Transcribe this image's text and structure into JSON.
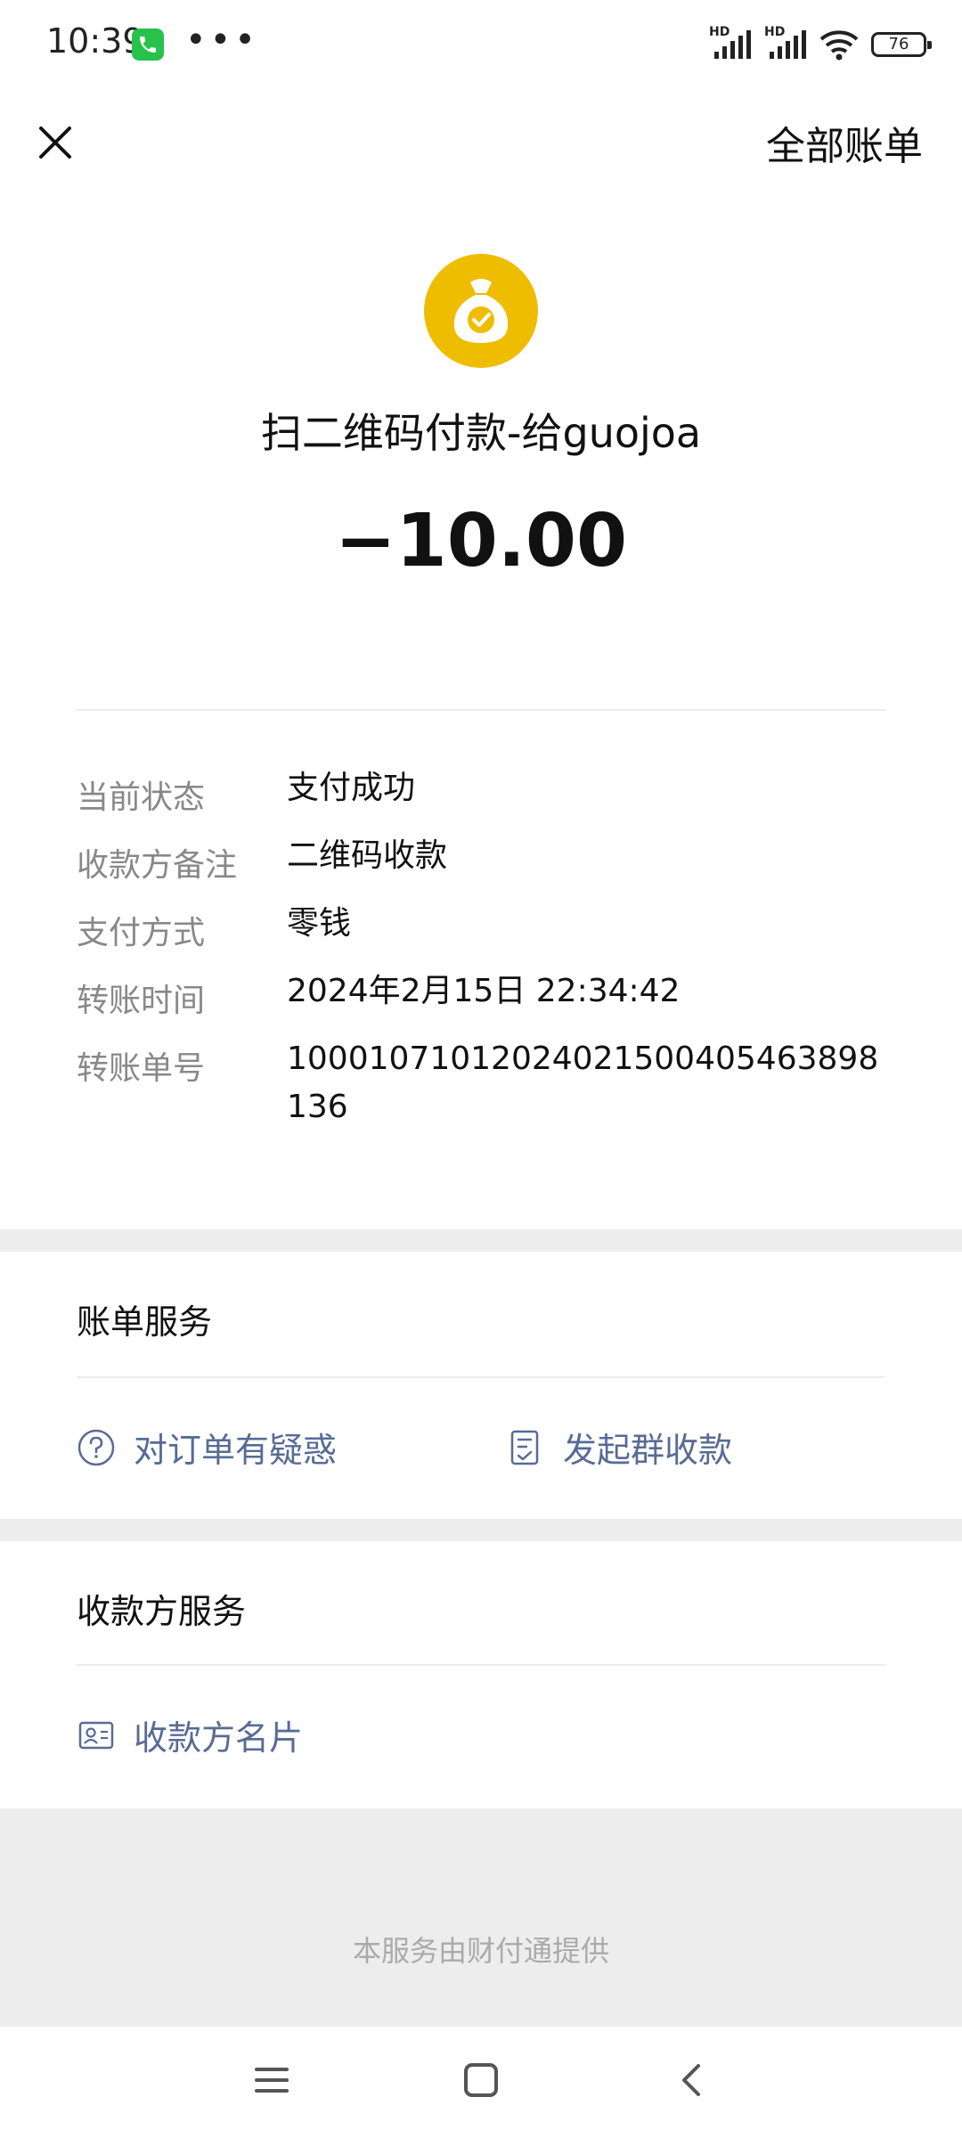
{
  "status_bar": {
    "time": "10:39",
    "dots": "•••",
    "signal1_label": "HD",
    "signal2_label": "HD",
    "battery_level": "76",
    "call_icon": "phone-icon"
  },
  "header": {
    "close_icon": "close-icon",
    "all_bills_label": "全部账单"
  },
  "transaction": {
    "logo_icon": "money-bag-check-icon",
    "title": "扫二维码付款-给guojoa",
    "amount": "−10.00",
    "details": [
      {
        "label": "当前状态",
        "value": "支付成功"
      },
      {
        "label": "收款方备注",
        "value": "二维码收款"
      },
      {
        "label": "支付方式",
        "value": "零钱"
      },
      {
        "label": "转账时间",
        "value": "2024年2月15日 22:34:42"
      },
      {
        "label": "转账单号",
        "value": "100010710120240215004054638981​36"
      }
    ]
  },
  "bill_service": {
    "title": "账单服务",
    "doubt_label": "对订单有疑惑",
    "group_collect_label": "发起群收款"
  },
  "payee_service": {
    "title": "收款方服务",
    "card_label": "收款方名片"
  },
  "footer": {
    "provider_text": "本服务由财付通提供"
  },
  "colors": {
    "accent_link": "#576b95",
    "logo_yellow": "#eebd00",
    "background": "#ededed"
  }
}
